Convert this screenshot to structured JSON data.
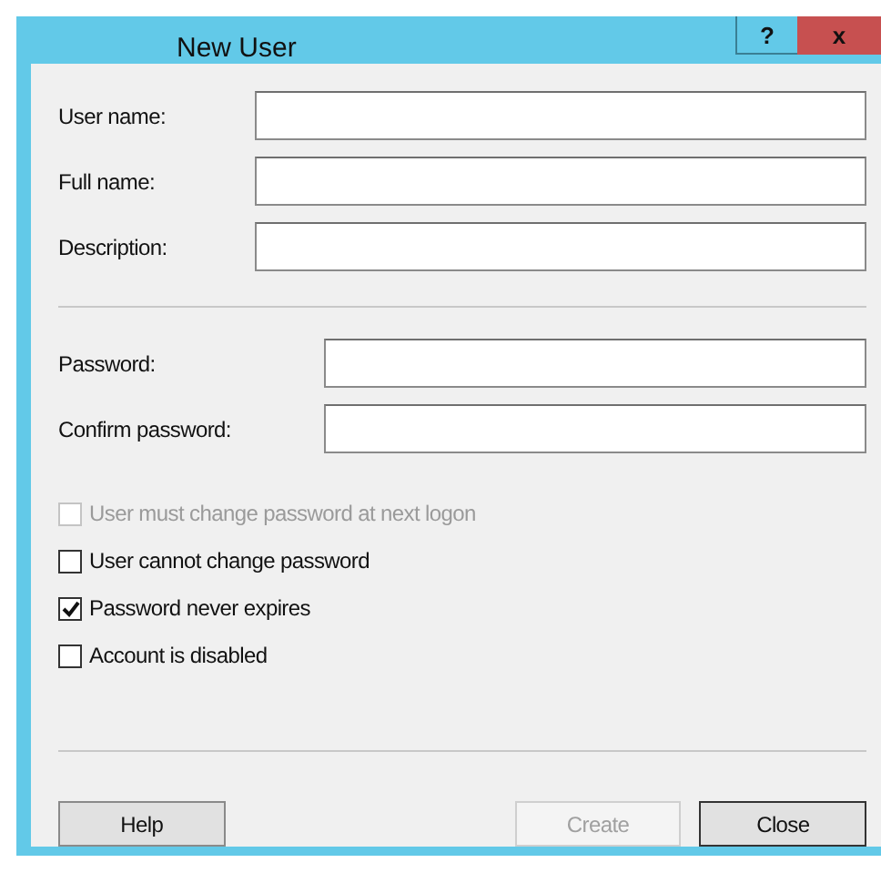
{
  "window": {
    "title": "New User",
    "help_button": "?",
    "close_button": "x"
  },
  "name_fields": [
    {
      "label": "User name:"
    },
    {
      "label": "Full name:"
    },
    {
      "label": "Description:"
    }
  ],
  "password_fields": [
    {
      "label": "Password:"
    },
    {
      "label": "Confirm password:"
    }
  ],
  "options": [
    {
      "label": "User must change password at next logon",
      "checked": false,
      "disabled": true
    },
    {
      "label": "User cannot change password",
      "checked": false,
      "disabled": false
    },
    {
      "label": "Password never expires",
      "checked": true,
      "disabled": false
    },
    {
      "label": "Account is disabled",
      "checked": false,
      "disabled": false
    }
  ],
  "buttons": [
    {
      "label": "Help",
      "disabled": false,
      "default": false
    },
    {
      "label": "Create",
      "disabled": true,
      "default": false
    },
    {
      "label": "Close",
      "disabled": false,
      "default": true
    }
  ]
}
